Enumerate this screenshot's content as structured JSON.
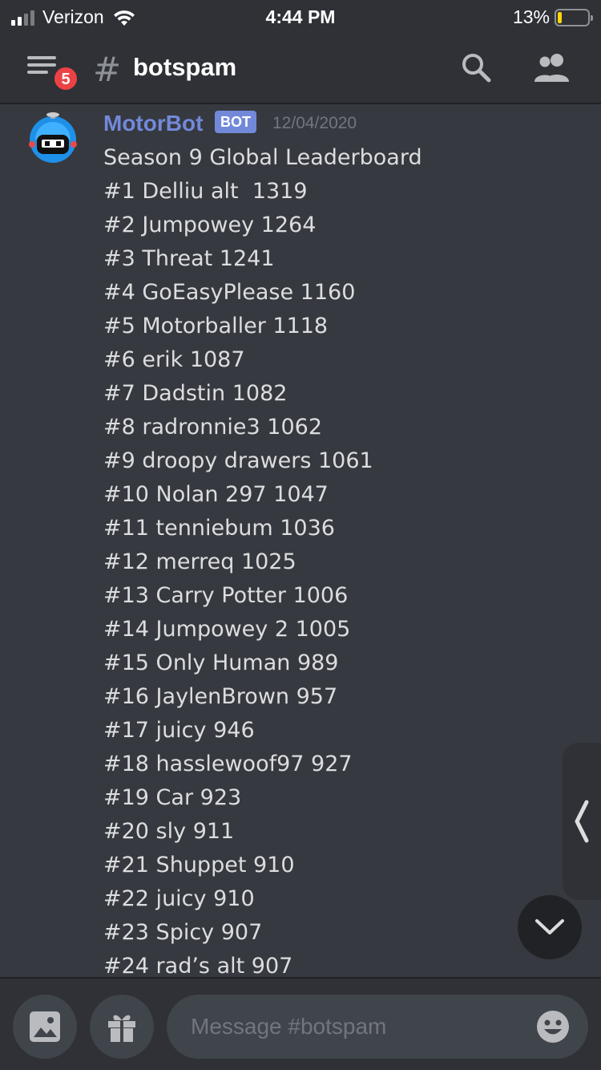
{
  "status_bar": {
    "carrier": "Verizon",
    "time": "4:44 PM",
    "battery": "13%"
  },
  "header": {
    "notification_count": "5",
    "channel_hash": "#",
    "channel_name": "botspam"
  },
  "message": {
    "author": "MotorBot",
    "bot_tag": "BOT",
    "timestamp": "12/04/2020",
    "lines": [
      "Season 9 Global Leaderboard",
      "#1 Delliu alt  1319",
      "#2 Jumpowey 1264",
      "#3 Threat 1241",
      "#4 GoEasyPlease 1160",
      "#5 Motorballer 1118",
      "#6 erik 1087",
      "#7 Dadstin 1082",
      "#8 radronnie3 1062",
      "#9 droopy drawers 1061",
      "#10 Nolan 297 1047",
      "#11 tenniebum 1036",
      "#12 merreq 1025",
      "#13 Carry Potter 1006",
      "#14 Jumpowey 2 1005",
      "#15 Only Human 989",
      "#16 JaylenBrown 957",
      "#17 juicy 946",
      "#18 hasslewoof97 927",
      "#19 Car 923",
      "#20 sly 911",
      "#21 Shuppet 910",
      "#22 juicy 910",
      "#23 Spicy 907",
      "#24 rad’s alt 907"
    ]
  },
  "input": {
    "placeholder": "Message #botspam"
  },
  "colors": {
    "background": "#36393f",
    "header": "#2f3136",
    "author": "#7289da",
    "badge": "#ed4245",
    "battery": "#ffd60a"
  },
  "icons": [
    "signal-icon",
    "wifi-icon",
    "battery-icon",
    "menu-icon",
    "search-icon",
    "members-icon",
    "chevron-left-icon",
    "chevron-down-icon",
    "image-icon",
    "gift-icon",
    "emoji-icon"
  ]
}
